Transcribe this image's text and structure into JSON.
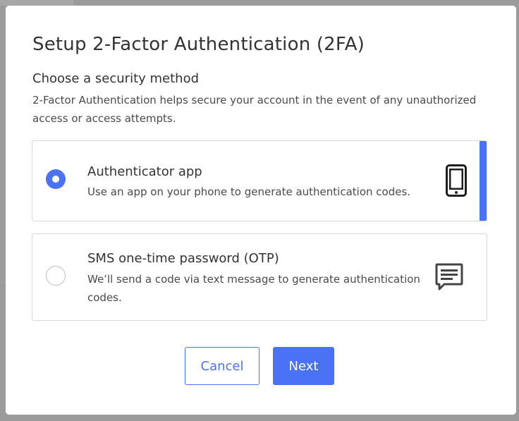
{
  "modal": {
    "title": "Setup 2-Factor Authentication (2FA)",
    "section_heading": "Choose a security method",
    "section_description": "2-Factor Authentication helps secure your account in the event of any unauthorized access or access attempts."
  },
  "options": [
    {
      "title": "Authenticator app",
      "description": "Use an app on your phone to generate authentication codes.",
      "selected": true,
      "icon": "smartphone-icon"
    },
    {
      "title": "SMS one-time password (OTP)",
      "description": "We’ll send a code via text message to generate authentication codes.",
      "selected": false,
      "icon": "chat-message-icon"
    }
  ],
  "buttons": {
    "cancel_label": "Cancel",
    "next_label": "Next"
  },
  "colors": {
    "accent": "#4a72f5",
    "title_text": "#333333",
    "body_text": "#4a4a4a",
    "border": "#d8d8d8",
    "overlay": "#9b9b9b"
  }
}
